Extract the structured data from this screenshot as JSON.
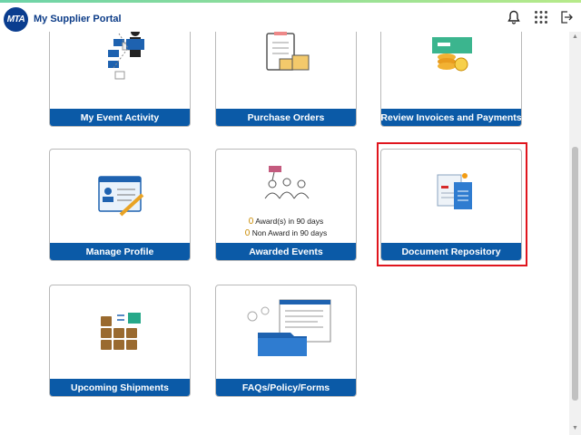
{
  "header": {
    "logo_text": "MTA",
    "title": "My Supplier Portal",
    "icons": [
      "bell-icon",
      "apps-grid-icon",
      "sign-out-icon"
    ]
  },
  "tiles": [
    {
      "label": "My Event Activity",
      "icon": "event-activity-icon"
    },
    {
      "label": "Purchase Orders",
      "icon": "purchase-orders-icon"
    },
    {
      "label": "Review Invoices and Payments",
      "icon": "invoices-payments-icon"
    },
    {
      "label": "Manage Profile",
      "icon": "profile-card-icon"
    },
    {
      "label": "Awarded Events",
      "icon": "award-people-icon",
      "stats": [
        {
          "count": "0",
          "text": "Award(s) in 90 days"
        },
        {
          "count": "0",
          "text": "Non Award in 90 days"
        }
      ]
    },
    {
      "label": "Document Repository",
      "icon": "documents-icon",
      "selected": true
    },
    {
      "label": "Upcoming Shipments",
      "icon": "shipment-boxes-icon"
    },
    {
      "label": "FAQs/Policy/Forms",
      "icon": "faq-folder-icon"
    }
  ],
  "colors": {
    "tile_bar": "#0b5aa7",
    "title_text": "#0b3b87",
    "highlight": "#e0151d",
    "count": "#c98a00"
  }
}
